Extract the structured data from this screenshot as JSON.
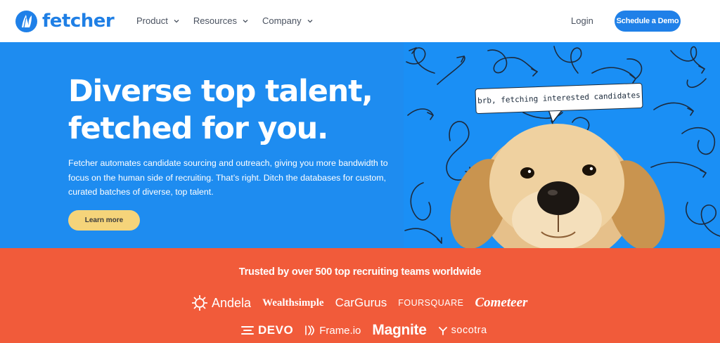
{
  "nav": {
    "logo_text": "fetcher",
    "menu": [
      {
        "label": "Product"
      },
      {
        "label": "Resources"
      },
      {
        "label": "Company"
      }
    ],
    "login_label": "Login",
    "cta_label": "Schedule a Demo"
  },
  "hero": {
    "headline_line1": "Diverse top talent,",
    "headline_line2": "fetched for you.",
    "subtext": "Fetcher automates candidate sourcing and outreach, giving you more bandwidth to focus on the human side of recruiting. That’s right. Ditch the databases for custom, curated batches of diverse, top talent.",
    "button_label": "Learn more",
    "speech_bubble": "brb, fetching interested candidates"
  },
  "trust": {
    "title": "Trusted by over 500 top recruiting teams worldwide",
    "logos_row1": [
      "Andela",
      "Wealthsimple",
      "CarGurus",
      "FOURSQUARE",
      "Cometeer"
    ],
    "logos_row2": [
      "DEVO",
      "Frame.io",
      "Magnite",
      "socotra"
    ]
  },
  "colors": {
    "brand_blue": "#1f80e8",
    "hero_blue": "#1e8cf0",
    "accent_yellow": "#f5d47a",
    "trust_orange": "#f15b3a"
  },
  "icons": [
    "fetcher-logo-icon",
    "chevron-down-icon",
    "andela-icon",
    "devo-icon",
    "frame-io-icon",
    "socotra-icon"
  ]
}
